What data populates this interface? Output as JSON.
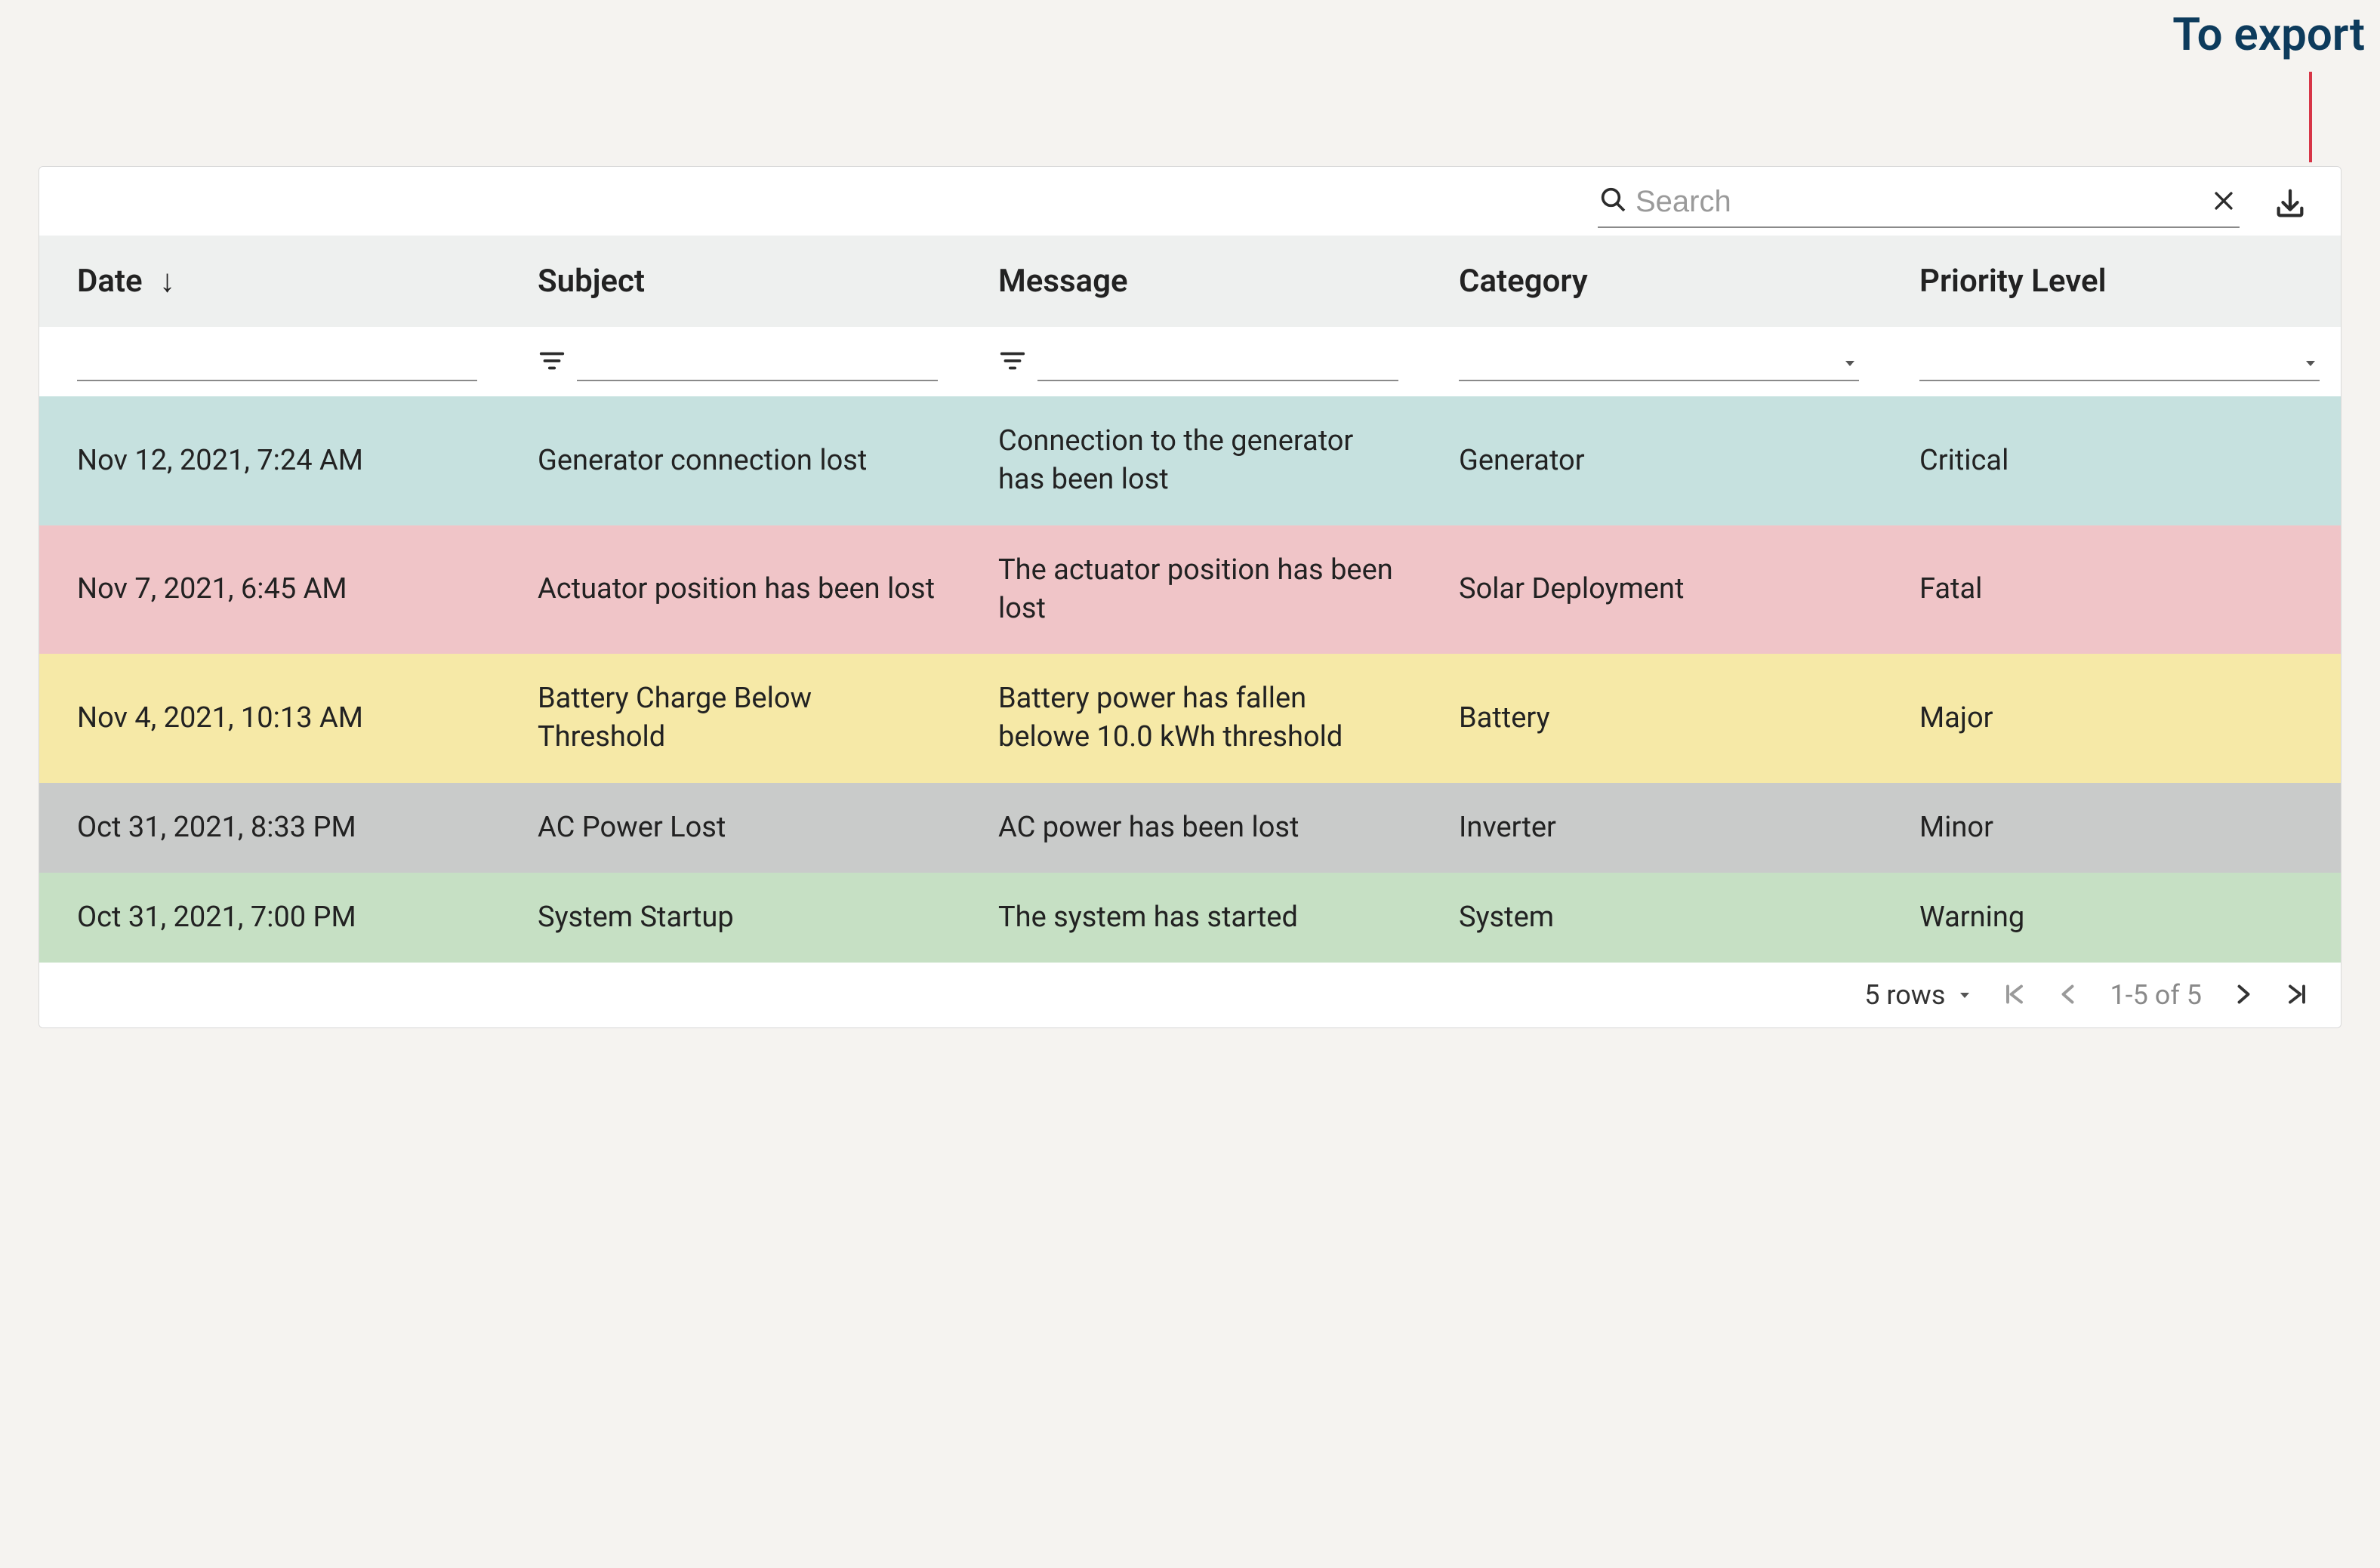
{
  "annotation": {
    "label": "To export"
  },
  "search": {
    "placeholder": "Search"
  },
  "columns": {
    "date": {
      "label": "Date",
      "sort_arrow": "↓"
    },
    "subject": {
      "label": "Subject"
    },
    "message": {
      "label": "Message"
    },
    "category": {
      "label": "Category"
    },
    "priority": {
      "label": "Priority Level"
    }
  },
  "rows": [
    {
      "date": "Nov 12, 2021, 7:24 AM",
      "subject": "Generator connection lost",
      "message": "Connection to the generator has been lost",
      "category": "Generator",
      "priority": "Critical",
      "css": "row-critical"
    },
    {
      "date": "Nov 7, 2021, 6:45 AM",
      "subject": "Actuator position has been lost",
      "message": "The actuator position has been lost",
      "category": "Solar Deployment",
      "priority": "Fatal",
      "css": "row-fatal"
    },
    {
      "date": "Nov 4, 2021, 10:13 AM",
      "subject": "Battery Charge Below Threshold",
      "message": "Battery power has fallen belowe 10.0 kWh threshold",
      "category": "Battery",
      "priority": "Major",
      "css": "row-major"
    },
    {
      "date": "Oct 31, 2021, 8:33 PM",
      "subject": "AC Power Lost",
      "message": "AC power has been lost",
      "category": "Inverter",
      "priority": "Minor",
      "css": "row-minor"
    },
    {
      "date": "Oct 31, 2021, 7:00 PM",
      "subject": "System Startup",
      "message": "The system has started",
      "category": "System",
      "priority": "Warning",
      "css": "row-warning"
    }
  ],
  "footer": {
    "rows_label": "5 rows",
    "range_label": "1-5 of 5"
  }
}
